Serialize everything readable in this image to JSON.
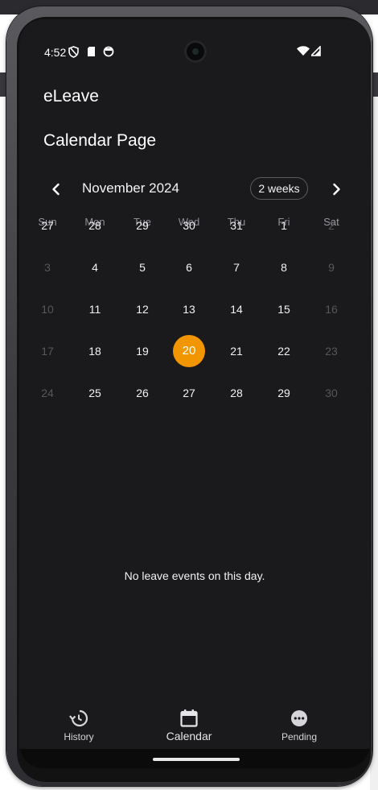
{
  "status": {
    "time": "4:52"
  },
  "app": {
    "title": "eLeave",
    "page_title": "Calendar Page"
  },
  "calendar": {
    "month_label": "November 2024",
    "format_button": "2 weeks",
    "weekdays": [
      "Sun",
      "Mon",
      "Tue",
      "Wed",
      "Thu",
      "Fri",
      "Sat"
    ],
    "weeks": [
      [
        "27",
        "28",
        "29",
        "30",
        "31",
        "1",
        "2"
      ],
      [
        "3",
        "4",
        "5",
        "6",
        "7",
        "8",
        "9"
      ],
      [
        "10",
        "11",
        "12",
        "13",
        "14",
        "15",
        "16"
      ],
      [
        "17",
        "18",
        "19",
        "20",
        "21",
        "22",
        "23"
      ],
      [
        "24",
        "25",
        "26",
        "27",
        "28",
        "29",
        "30"
      ]
    ],
    "selected_day": "20",
    "accent_color": "#f29600"
  },
  "events": {
    "empty_message": "No leave events on this day."
  },
  "bottom_nav": {
    "items": [
      {
        "label": "History",
        "icon": "history-icon"
      },
      {
        "label": "Calendar",
        "icon": "calendar-icon"
      },
      {
        "label": "Pending",
        "icon": "pending-icon"
      }
    ],
    "active": "Calendar"
  }
}
